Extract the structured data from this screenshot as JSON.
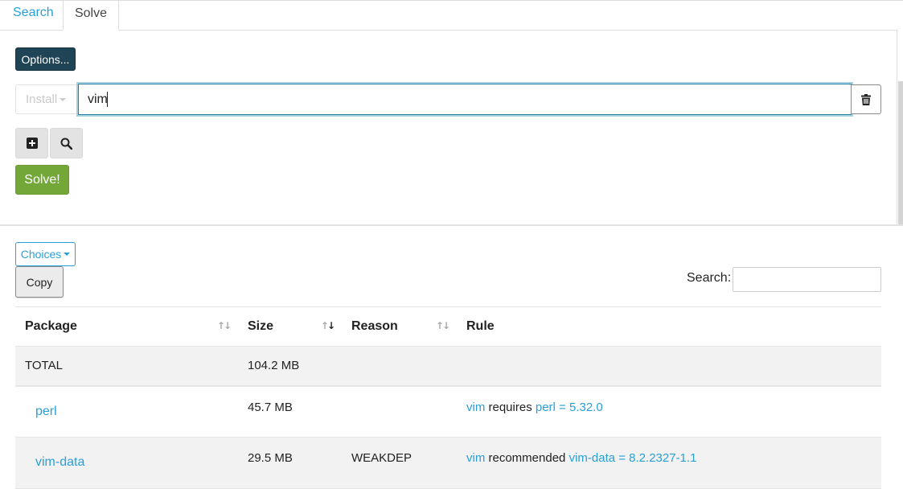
{
  "tabs": [
    {
      "label": "Search",
      "active": false
    },
    {
      "label": "Solve",
      "active": true
    }
  ],
  "toolbar": {
    "options_label": "Options...",
    "install_label": "Install",
    "query_value": "vim",
    "solve_label": "Solve!"
  },
  "results": {
    "choices_label": "Choices",
    "copy_label": "Copy",
    "search_label": "Search:",
    "search_value": "",
    "columns": [
      "Package",
      "Size",
      "Reason",
      "Rule"
    ],
    "sort": {
      "column": "Size",
      "direction": "descending"
    },
    "total": {
      "label": "TOTAL",
      "size": "104.2 MB"
    },
    "rows": [
      {
        "package": "perl",
        "size": "45.7 MB",
        "reason": "",
        "rule_subject": "vim",
        "rule_verb": "requires",
        "rule_object": "perl = 5.32.0"
      },
      {
        "package": "vim-data",
        "size": "29.5 MB",
        "reason": "WEAKDEP",
        "rule_subject": "vim",
        "rule_verb": "recommended",
        "rule_object": "vim-data = 8.2.2327-1.1"
      }
    ]
  },
  "colors": {
    "link": "#2a9fd6",
    "options_bg": "#1e4456",
    "solve_bg": "#73a839",
    "focus_border": "#2a7f9a"
  },
  "icons": [
    "trash-icon",
    "plus-square-icon",
    "search-icon",
    "sort-icon"
  ]
}
